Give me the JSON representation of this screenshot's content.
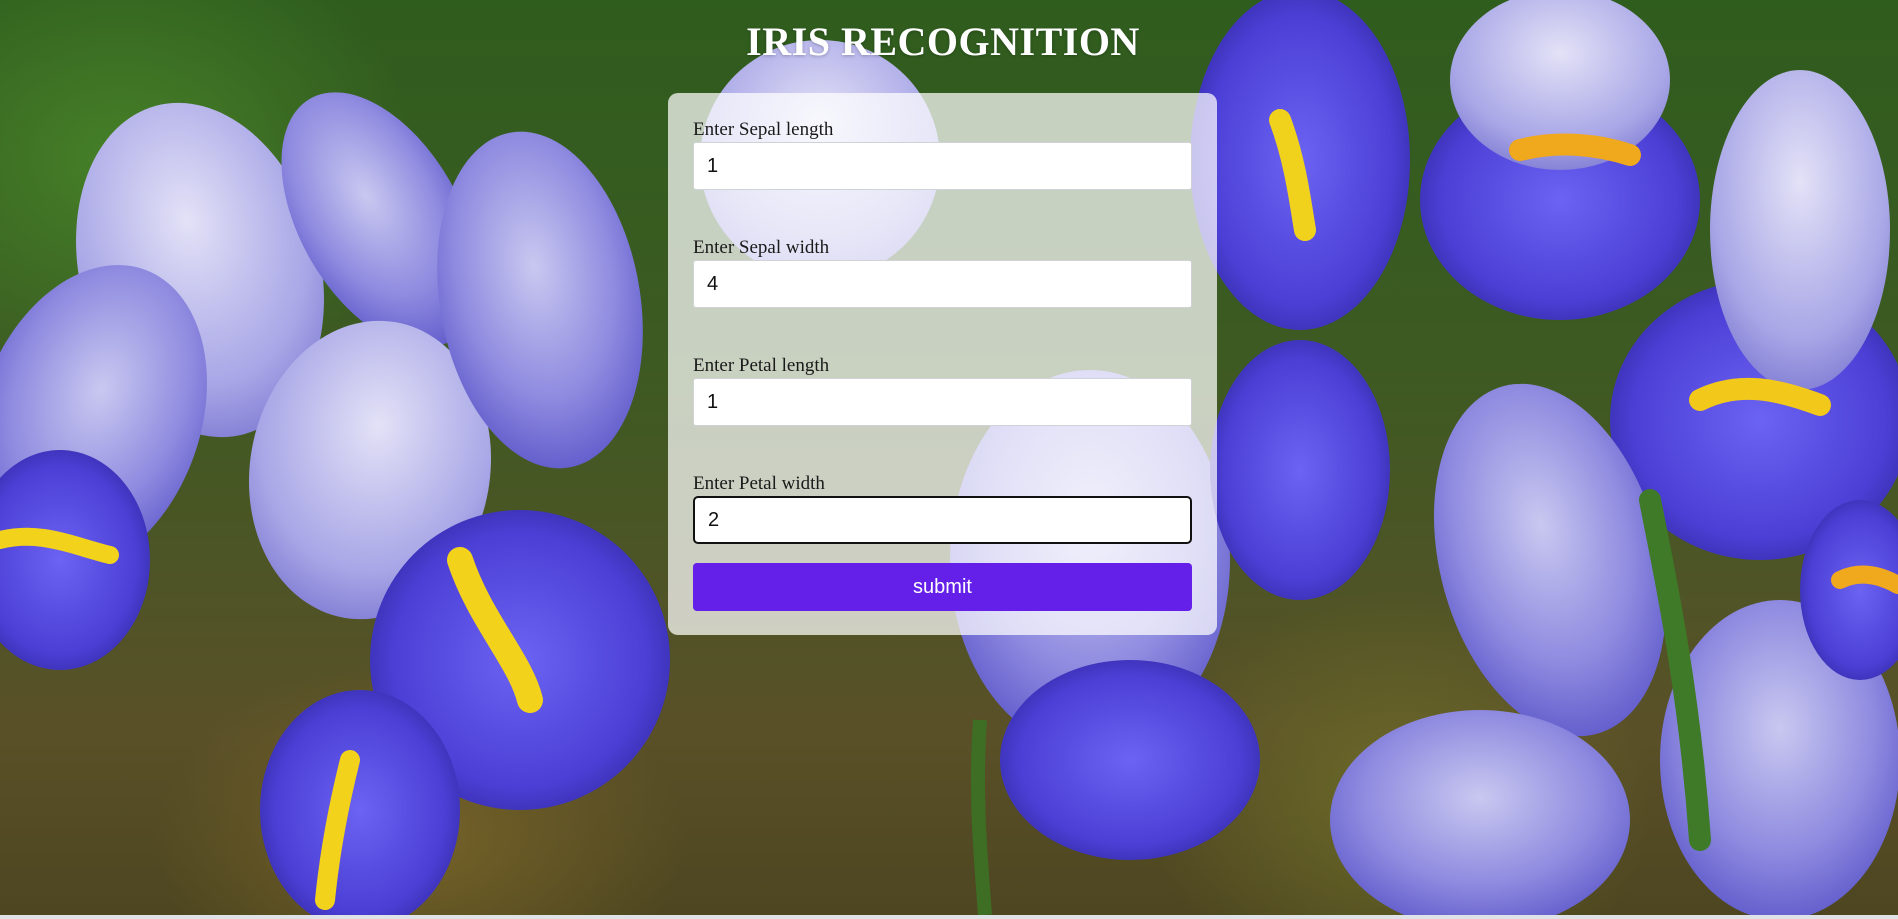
{
  "page": {
    "title": "IRIS RECOGNITION"
  },
  "form": {
    "fields": [
      {
        "label": "Enter Sepal length",
        "value": "1"
      },
      {
        "label": "Enter Sepal width",
        "value": "4"
      },
      {
        "label": "Enter Petal length",
        "value": "1"
      },
      {
        "label": "Enter Petal width",
        "value": "2"
      }
    ],
    "submit_label": "submit"
  },
  "colors": {
    "submit_button": "#6420e8",
    "title_text": "#ffffff",
    "panel": "rgba(255,255,255,0.72)"
  },
  "background": {
    "icon": "iris-flowers-photo"
  }
}
